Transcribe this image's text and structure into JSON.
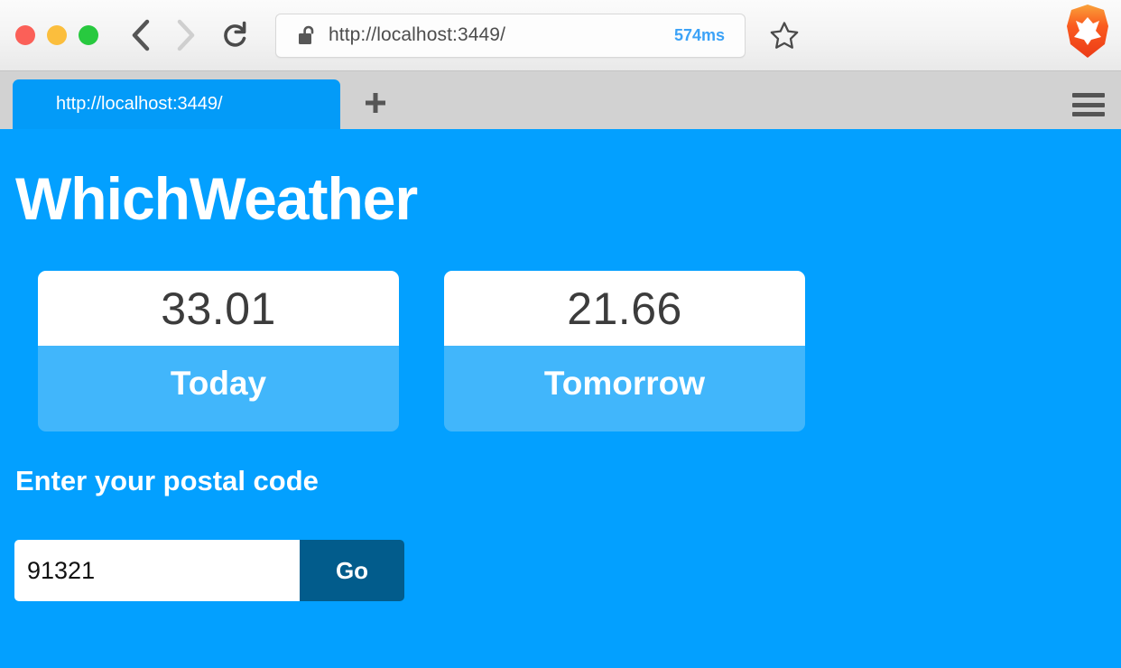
{
  "browser": {
    "window_controls": {
      "close": "close-window",
      "minimize": "minimize-window",
      "zoom": "zoom-window"
    },
    "back_label": "Back",
    "forward_label": "Forward",
    "reload_label": "Reload",
    "address": {
      "url": "http://localhost:3449/",
      "placeholder": "Enter a URL",
      "security": "unlocked-padlock",
      "load_time": "574ms",
      "load_time_color": "#3ba2f7"
    },
    "bookmark_label": "Bookmark this page",
    "brand_logo": "brave-lion-logo",
    "tabs": [
      {
        "title": "http://localhost:3449/",
        "active": true
      }
    ],
    "new_tab_label": "+",
    "menu_label": "Main menu"
  },
  "page": {
    "title": "WhichWeather",
    "background_color": "#03a0ff",
    "cards": [
      {
        "value": "33.01",
        "label": "Today"
      },
      {
        "value": "21.66",
        "label": "Tomorrow"
      }
    ],
    "card_footer_color": "#41b6fb",
    "form": {
      "label": "Enter your postal code",
      "input_value": "91321",
      "input_placeholder": "Postal code",
      "submit_label": "Go",
      "submit_color": "#025c8c"
    }
  }
}
